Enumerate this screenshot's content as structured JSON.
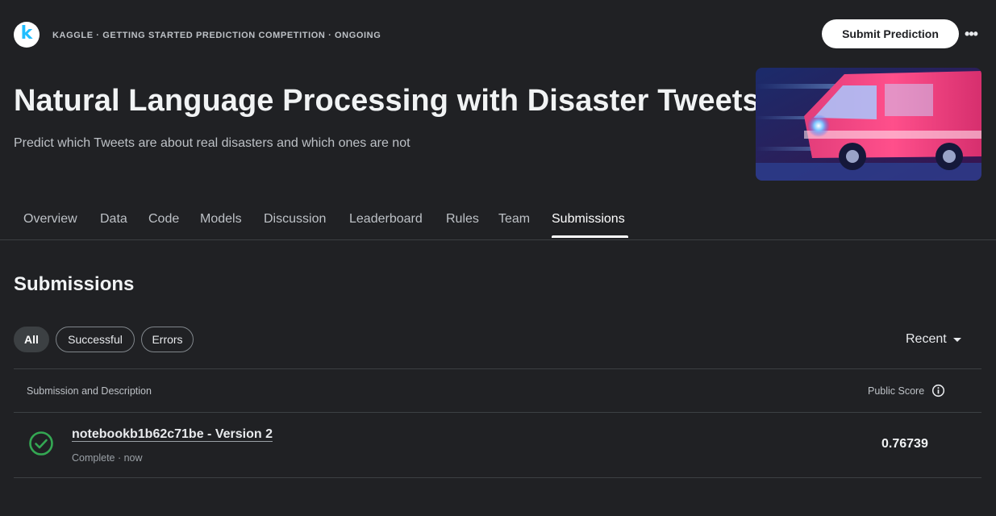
{
  "header": {
    "logo_letter": "k",
    "breadcrumb": "KAGGLE · GETTING STARTED PREDICTION COMPETITION · ONGOING",
    "submit_button": "Submit Prediction",
    "more_icon": "more-horizontal-icon"
  },
  "competition": {
    "title": "Natural Language Processing with Disaster Tweets",
    "subtitle": "Predict which Tweets are about real disasters and which ones are not"
  },
  "tabs": [
    {
      "label": "Overview"
    },
    {
      "label": "Data"
    },
    {
      "label": "Code"
    },
    {
      "label": "Models"
    },
    {
      "label": "Discussion"
    },
    {
      "label": "Leaderboard"
    },
    {
      "label": "Rules"
    },
    {
      "label": "Team"
    },
    {
      "label": "Submissions",
      "active": true
    }
  ],
  "submissions": {
    "heading": "Submissions",
    "filters": [
      "All",
      "Successful",
      "Errors"
    ],
    "active_filter": "All",
    "sort_label": "Recent",
    "columns": {
      "description": "Submission and Description",
      "score": "Public Score"
    },
    "rows": [
      {
        "name": "notebookb1b62c71be - Version 2",
        "status": "Complete · now",
        "score": "0.76739",
        "status_icon": "check-circle-icon"
      }
    ]
  },
  "colors": {
    "background": "#202124",
    "success": "#34a853",
    "brand": "#20beff"
  }
}
